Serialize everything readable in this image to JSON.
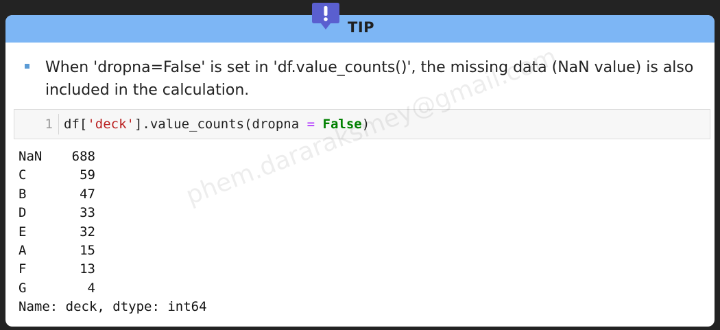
{
  "tip": {
    "title": "TIP",
    "badge_icon": "exclamation-badge-icon",
    "bullet": "When 'dropna=False' is set in 'df.value_counts()', the missing data (NaN value) is also included in the calculation."
  },
  "code_cell": {
    "line_number": "1",
    "tokens": {
      "t1": "df[",
      "t2": "'deck'",
      "t3": "].value_counts(dropna ",
      "t4": "=",
      "t5": " ",
      "t6": "False",
      "t7": ")"
    }
  },
  "output": {
    "rows": [
      {
        "key": "NaN",
        "value": "688"
      },
      {
        "key": "C",
        "value": "59"
      },
      {
        "key": "B",
        "value": "47"
      },
      {
        "key": "D",
        "value": "33"
      },
      {
        "key": "E",
        "value": "32"
      },
      {
        "key": "A",
        "value": "15"
      },
      {
        "key": "F",
        "value": "13"
      },
      {
        "key": "G",
        "value": "4"
      }
    ],
    "footer": "Name: deck, dtype: int64"
  },
  "watermark": "phem.dararaksmey@gmail.com",
  "colors": {
    "header": "#7db6f5",
    "badge": "#5a5fcf",
    "bullet": "#5b9bd5",
    "string": "#ba2121",
    "operator": "#aa22ff",
    "keyword": "#008000"
  }
}
